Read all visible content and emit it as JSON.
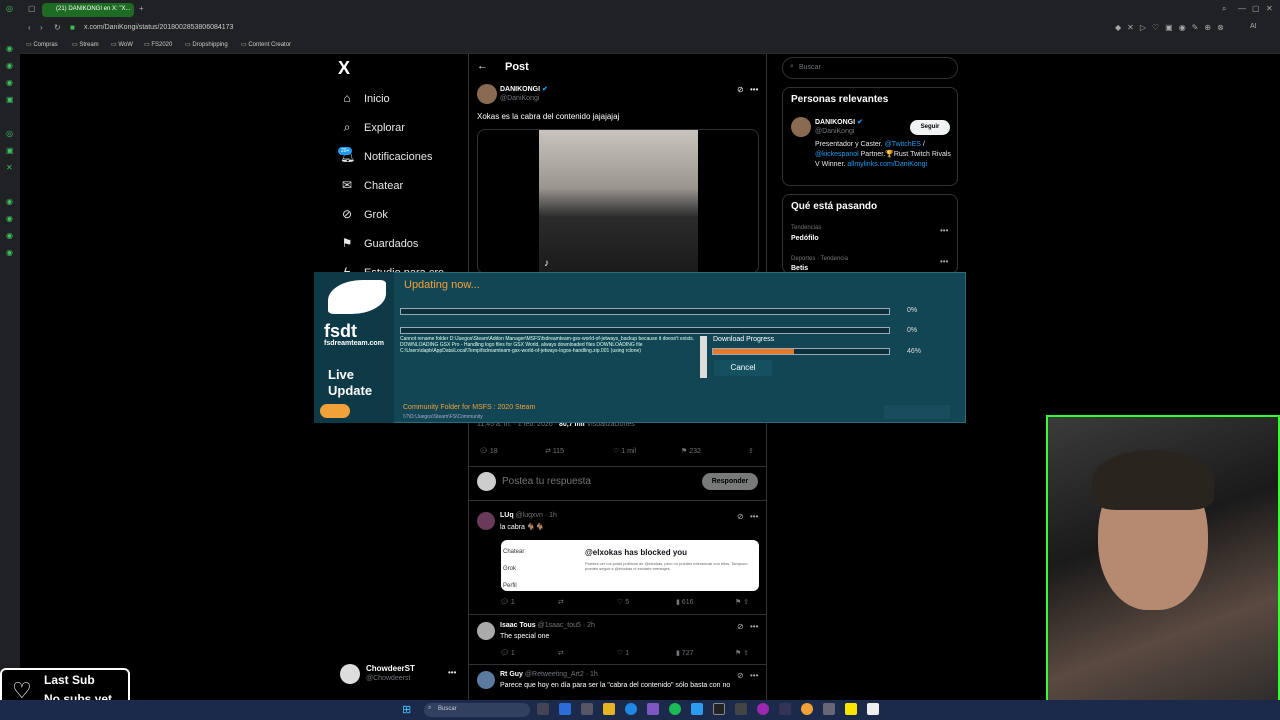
{
  "browser": {
    "tab_title": "(21) DANIKONGI en X: \"X...",
    "url": "x.com/DaniKongi/status/2018002853806084173",
    "bookmarks": [
      "Compras",
      "Stream",
      "WoW",
      "FS2020",
      "Dropshipping",
      "Content Creator"
    ],
    "ai_label": "AI"
  },
  "nav": {
    "logo": "X",
    "items": [
      "Inicio",
      "Explorar",
      "Notificaciones",
      "Chatear",
      "Grok",
      "Guardados",
      "Estudio para cre..."
    ],
    "badge": "20+",
    "account_name": "ChowdeerST",
    "account_handle": "@Chowdeerst"
  },
  "post": {
    "header": "Post",
    "author": "DANIKONGI",
    "handle": "@DaniKongi",
    "text": "Xokas es la cabra del contenido jajajajaj",
    "meta_time": "11:45 a. m. · 1 feb. 2026 · ",
    "meta_views": "80,7 mil",
    "meta_views_label": " Visualizaciones",
    "stats": {
      "replies": "18",
      "reposts": "115",
      "likes": "1 mil",
      "bookmarks": "232"
    },
    "reply_placeholder": "Postea tu respuesta",
    "reply_button": "Responder"
  },
  "replies": [
    {
      "name": "LUq",
      "handle": "@luqxvn · 1h",
      "text": "la cabra 🐐🐐",
      "replies": "1",
      "likes": "5",
      "views": "616"
    },
    {
      "name": "Isaac Tous",
      "handle": "@1saac_tou5 · 2h",
      "text": "The special one",
      "replies": "1",
      "likes": "1",
      "views": "727"
    },
    {
      "name": "Rt Guy",
      "handle": "@Retweeting_Art2 · 1h",
      "text": "Parece que hoy en día para ser la \"cabra del contenido\" sólo basta con no"
    }
  ],
  "blocked_card": {
    "menu": [
      "Chatear",
      "Grok",
      "Perfil"
    ],
    "title": "@elxokas has blocked you",
    "body": "Puedes ver los posts públicos de @elxokas, pero no puedes interactuar con ellos. Tampoco puedes seguir a @elxokas ni enviarle mensajes."
  },
  "right": {
    "search_placeholder": "Buscar",
    "relevant_title": "Personas relevantes",
    "person_name": "DANIKONGI",
    "person_handle": "@DaniKongi",
    "follow": "Seguir",
    "bio_a": "Presentador y Caster. ",
    "bio_link1": "@TwitchES",
    "bio_b": " / ",
    "bio_link2": "@kickespanol",
    "bio_c": " Partner.🏆Rust Twitch Rivals V Winner.",
    "bio_link3": "allmylinks.com/DaniKongi",
    "trending_title": "Qué está pasando",
    "trends": [
      {
        "context": "Tendencias",
        "topic": "Pedófilo"
      },
      {
        "context": "Deportes · Tendencia",
        "topic": "Betis"
      }
    ]
  },
  "updater": {
    "title": "Updating now...",
    "brand": "fsdt",
    "domain": "fsdreamteam.com",
    "live": "Live",
    "update": "Update",
    "bar1_pct": "0%",
    "bar2_pct": "0%",
    "download_label": "Download Progress",
    "download_pct": "46%",
    "download_fraction": 0.46,
    "log": "Cannot rename folder D:\\Juegos\\Steam\\Addon Manager\\MSFS\\fsdreamteam-gsx-world-of-jetways_backup because it doesn't exists.\nDOWNLOADING GSX Pro - Handling logo files for GSX World, always downloaded files\nDOWNLOADING file C:\\Users\\dapb\\AppData\\Local\\Temp\\fsdreamteam-gsx-world-of-jetways-logos-handling.zip.001 (using rclone)",
    "cancel": "Cancel",
    "community": "Community Folder for MSFS : 2020 Steam",
    "community_path": "\\\\?\\D:\\Juegos\\Steam\\FS\\Community"
  },
  "overlay": {
    "line1": "Last Sub",
    "line2": "No subs yet"
  },
  "taskbar": {
    "search": "Buscar"
  }
}
